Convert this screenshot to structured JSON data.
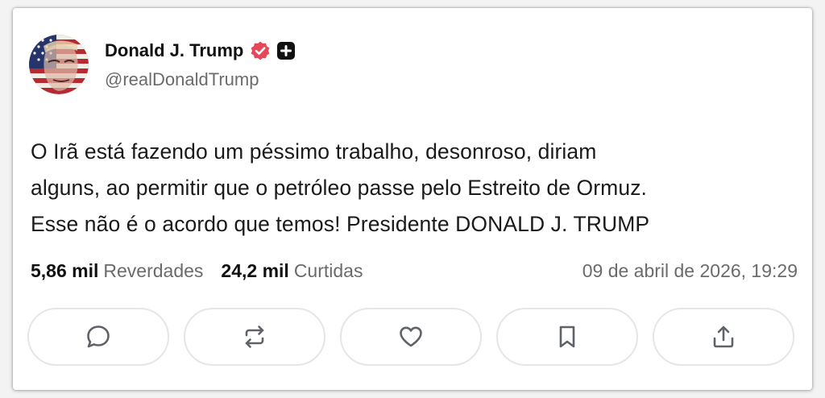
{
  "author": {
    "name": "Donald J. Trump",
    "handle": "@realDonaldTrump",
    "avatar_icon": "flag-portrait-avatar",
    "verified_icon": "verified-badge-icon",
    "plus_icon": "plus-badge-icon",
    "verified_color": "#e8475a"
  },
  "post": {
    "lines": [
      "O Irã está fazendo um péssimo trabalho, desonroso, diriam",
      "alguns, ao permitir que o petróleo passe pelo Estreito de Ormuz.",
      "Esse não é o acordo que temos! Presidente DONALD J. TRUMP"
    ]
  },
  "stats": {
    "reposts_count": "5,86 mil",
    "reposts_label": "Reverdades",
    "likes_count": "24,2 mil",
    "likes_label": "Curtidas",
    "date": "09 de abril de 2026, 19:29"
  },
  "actions": [
    {
      "name": "reply-button",
      "icon": "comment-icon"
    },
    {
      "name": "retruth-button",
      "icon": "repost-icon"
    },
    {
      "name": "like-button",
      "icon": "heart-icon"
    },
    {
      "name": "bookmark-button",
      "icon": "bookmark-icon"
    },
    {
      "name": "share-button",
      "icon": "share-icon"
    }
  ]
}
